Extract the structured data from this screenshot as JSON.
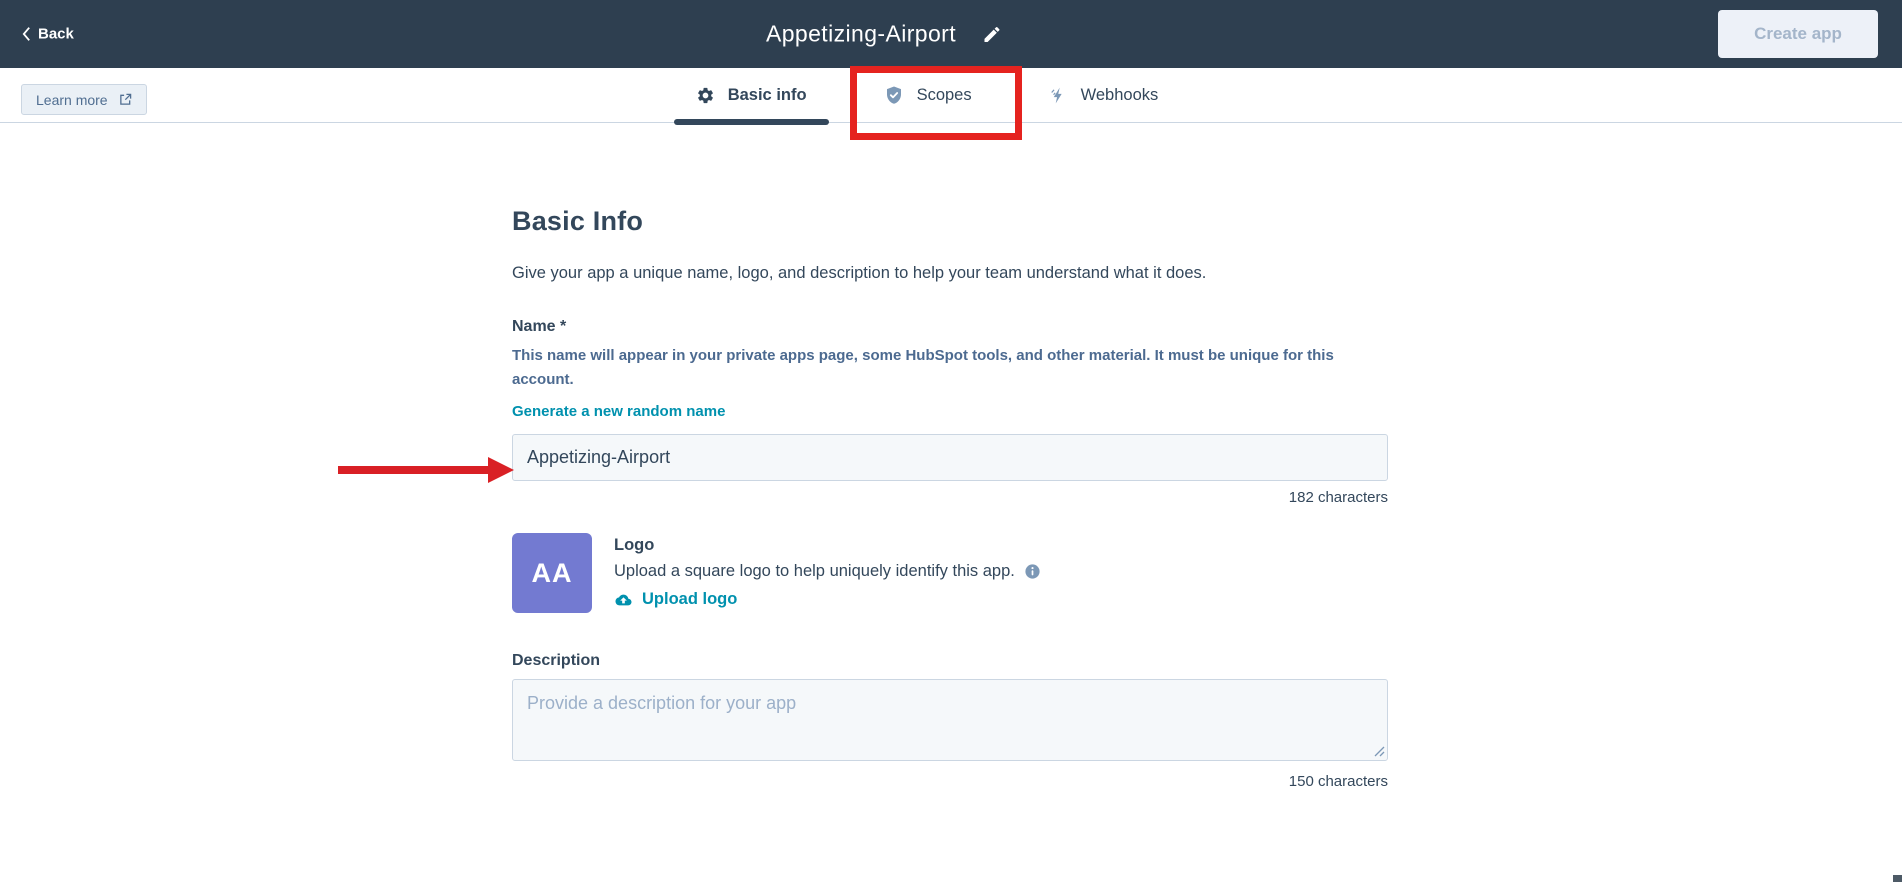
{
  "header": {
    "back_label": "Back",
    "title": "Appetizing-Airport",
    "create_app_label": "Create app"
  },
  "tabbar": {
    "learn_more_label": "Learn more",
    "tabs": [
      {
        "label": "Basic info",
        "icon": "gear-icon",
        "active": true
      },
      {
        "label": "Scopes",
        "icon": "shield-check-icon",
        "active": false,
        "annotated": true
      },
      {
        "label": "Webhooks",
        "icon": "lightning-icon",
        "active": false
      }
    ]
  },
  "main": {
    "heading": "Basic Info",
    "subheading": "Give your app a unique name, logo, and description to help your team understand what it does.",
    "name_field": {
      "label": "Name *",
      "help": "This name will appear in your private apps page, some HubSpot tools, and other material. It must be unique for this account.",
      "generate_link": "Generate a new random name",
      "value": "Appetizing-Airport",
      "char_count": "182 characters"
    },
    "logo_section": {
      "avatar_text": "AA",
      "label": "Logo",
      "help": "Upload a square logo to help uniquely identify this app.",
      "upload_label": "Upload logo"
    },
    "description_field": {
      "label": "Description",
      "placeholder": "Provide a description for your app",
      "char_count": "150 characters"
    }
  },
  "annotations": {
    "highlight_box_target": "Scopes tab",
    "arrow_target": "Name input",
    "color": "#e5231f"
  },
  "colors": {
    "header_bg": "#2e3f50",
    "accent_teal": "#0091ae",
    "text_navy": "#33475b",
    "avatar_purple": "#737ad1",
    "border_gray": "#cbd6e2",
    "field_bg": "#f5f8fa"
  }
}
